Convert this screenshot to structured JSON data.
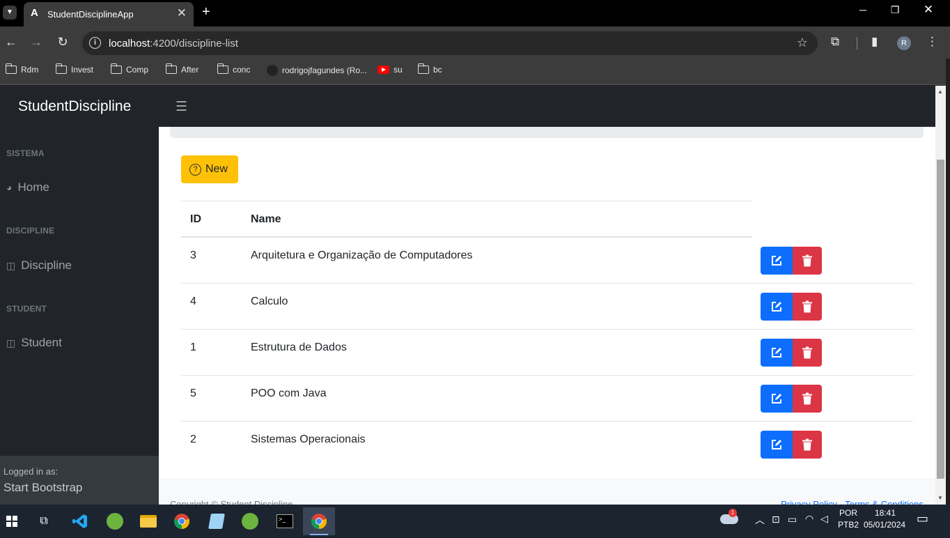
{
  "browser": {
    "tab_title": "StudentDisciplineApp",
    "url_host": "localhost",
    "url_path": ":4200/discipline-list",
    "bookmarks": [
      "Rdm",
      "Invest",
      "Comp",
      "After",
      "conc",
      "rodrigojfagundes (Ro...",
      "su",
      "bc"
    ],
    "profile_initial": "R"
  },
  "app": {
    "brand": "StudentDiscipline",
    "sidebar": {
      "sections": [
        {
          "heading": "SISTEMA",
          "item": "Home"
        },
        {
          "heading": "DISCIPLINE",
          "item": "Discipline"
        },
        {
          "heading": "STUDENT",
          "item": "Student"
        }
      ],
      "footer_label": "Logged in as:",
      "footer_user": "Start Bootstrap"
    },
    "new_button": "New",
    "table": {
      "headers": [
        "ID",
        "Name"
      ],
      "rows": [
        {
          "id": "3",
          "name": "Arquitetura e Organização de Computadores"
        },
        {
          "id": "4",
          "name": "Calculo"
        },
        {
          "id": "1",
          "name": "Estrutura de Dados"
        },
        {
          "id": "5",
          "name": "POO com Java"
        },
        {
          "id": "2",
          "name": "Sistemas Operacionais"
        }
      ]
    },
    "footer": {
      "copyright": "Copyright © Student Discipline",
      "links": "Privacy Policy · Terms & Conditions"
    }
  },
  "taskbar": {
    "weather_badge": "1",
    "lang": "POR",
    "layout": "PTB2",
    "time": "18:41",
    "date": "05/01/2024"
  },
  "colors": {
    "primary": "#0d6efd",
    "danger": "#dc3545",
    "warning": "#ffc107",
    "dark": "#212529"
  }
}
